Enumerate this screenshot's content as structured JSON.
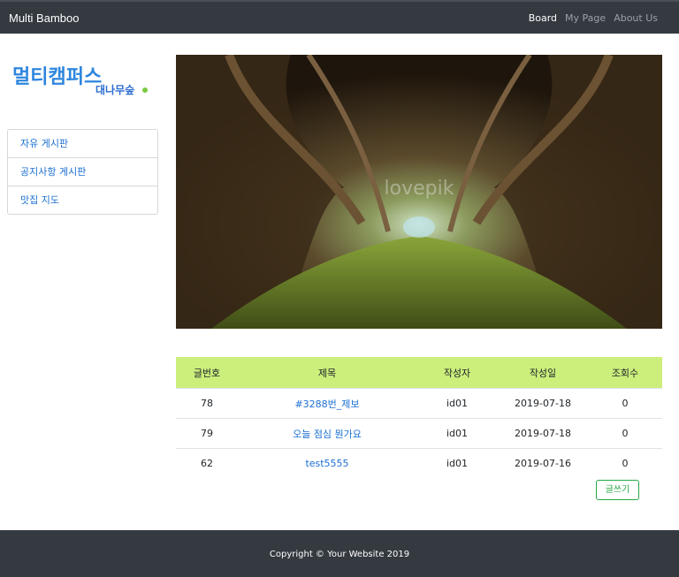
{
  "navbar": {
    "brand": "Multi Bamboo",
    "links": [
      {
        "label": "Board"
      },
      {
        "label": "My Page"
      },
      {
        "label": "About Us"
      }
    ]
  },
  "logo": {
    "line1": "멀티캠퍼스",
    "line2": "대나무숲"
  },
  "sidebar": {
    "items": [
      {
        "label": "자유 게시판"
      },
      {
        "label": "공지사항 게시판"
      },
      {
        "label": "맛집 지도"
      }
    ]
  },
  "hero": {
    "watermark": "lovepik"
  },
  "board": {
    "headers": [
      "글번호",
      "제목",
      "작성자",
      "작성일",
      "조회수"
    ],
    "rows": [
      {
        "no": "78",
        "title": "#3288번_제보",
        "author": "id01",
        "date": "2019-07-18",
        "views": "0"
      },
      {
        "no": "79",
        "title": "오늘 점심 뭔가요",
        "author": "id01",
        "date": "2019-07-18",
        "views": "0"
      },
      {
        "no": "62",
        "title": "test5555",
        "author": "id01",
        "date": "2019-07-16",
        "views": "0"
      }
    ],
    "write_button": "글쓰기"
  },
  "footer": {
    "copyright": "Copyright © Your Website 2019"
  },
  "colors": {
    "navbar": "#343a40",
    "table_header": "#ccef7c",
    "link": "#1a6fd1",
    "button": "#28a745"
  }
}
